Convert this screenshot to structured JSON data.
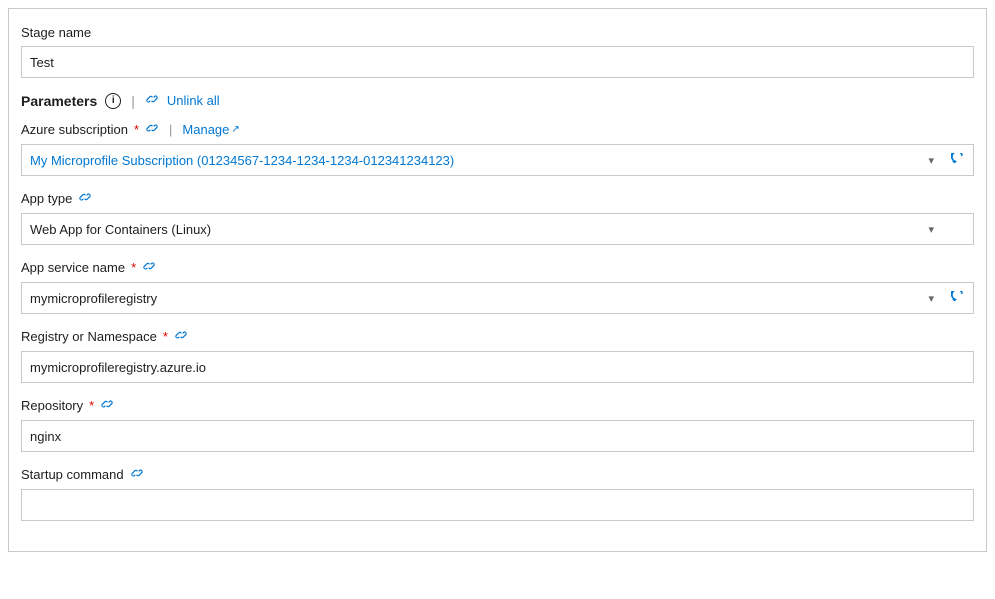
{
  "stage": {
    "name_label": "Stage name",
    "name_value": "Test"
  },
  "parameters": {
    "label": "Parameters",
    "info_icon": "ⓘ",
    "separator": "|",
    "unlink_all_label": "Unlink all",
    "chain_icon": "🔗"
  },
  "azure_subscription": {
    "label": "Azure subscription",
    "required": "*",
    "chain_icon": "🔗",
    "separator": "|",
    "manage_label": "Manage",
    "external_icon": "↗",
    "value": "My Microprofile Subscription (01234567-1234-1234-1234-012341234123)"
  },
  "app_type": {
    "label": "App type",
    "chain_icon": "🔗",
    "value": "Web App for Containers (Linux)"
  },
  "app_service_name": {
    "label": "App service name",
    "required": "*",
    "chain_icon": "🔗",
    "value": "mymicroprofileregistry"
  },
  "registry_namespace": {
    "label": "Registry or Namespace",
    "required": "*",
    "chain_icon": "🔗",
    "value": "mymicroprofileregistry.azure.io"
  },
  "repository": {
    "label": "Repository",
    "required": "*",
    "chain_icon": "🔗",
    "value": "nginx"
  },
  "startup_command": {
    "label": "Startup command",
    "chain_icon": "🔗",
    "value": ""
  }
}
